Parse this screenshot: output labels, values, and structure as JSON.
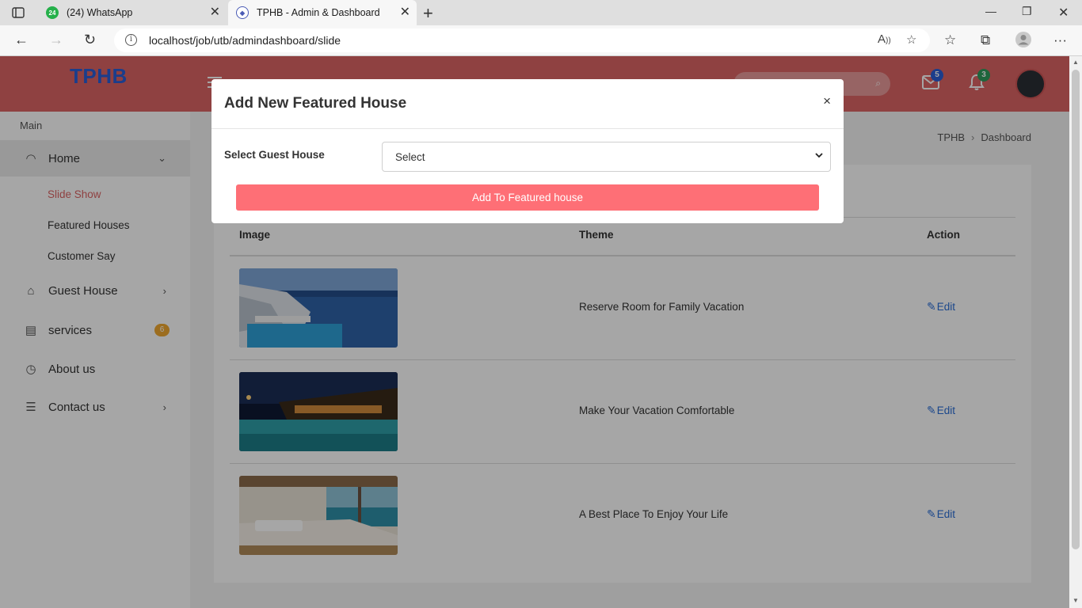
{
  "browser": {
    "tabs": [
      {
        "label": "(24) WhatsApp",
        "favicon_badge": "24"
      },
      {
        "label": "TPHB - Admin & Dashboard"
      }
    ],
    "url": "localhost/job/utb/admindashboard/slide"
  },
  "header": {
    "brand": "TPHB",
    "mail_count": "5",
    "notification_count": "3"
  },
  "sidebar": {
    "heading": "Main",
    "items": [
      {
        "label": "Home",
        "icon": "gauge-icon"
      },
      {
        "label": "Guest House",
        "icon": "home-icon"
      },
      {
        "label": "services",
        "icon": "document-icon",
        "badge": "6"
      },
      {
        "label": "About us",
        "icon": "clock-icon"
      },
      {
        "label": "Contact us",
        "icon": "list-icon"
      }
    ],
    "home_subitems": [
      "Slide Show",
      "Featured Houses",
      "Customer Say"
    ]
  },
  "breadcrumb": {
    "root": "TPHB",
    "current": "Dashboard"
  },
  "table": {
    "headers": {
      "image": "Image",
      "theme": "Theme",
      "action": "Action"
    },
    "rows": [
      {
        "theme": "Reserve Room for Family Vacation",
        "action": "Edit"
      },
      {
        "theme": "Make Your Vacation Comfortable",
        "action": "Edit"
      },
      {
        "theme": "A Best Place To Enjoy Your Life",
        "action": "Edit"
      }
    ]
  },
  "modal": {
    "title": "Add New Featured House",
    "close": "×",
    "field_label": "Select Guest House",
    "select_value": "Select",
    "submit_label": "Add To Featured house"
  },
  "colors": {
    "topnav": "#dc6464",
    "brand": "#2a5fd6",
    "submit_button": "#fe6f76",
    "edit_link": "#2a6dd6",
    "active_subitem": "#dc6464"
  }
}
